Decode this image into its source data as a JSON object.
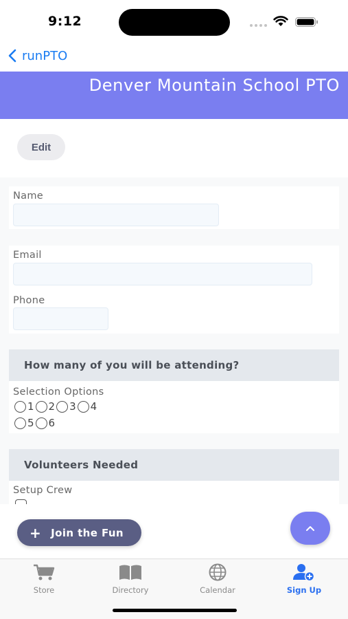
{
  "status": {
    "time": "9:12"
  },
  "nav": {
    "back_label": "runPTO"
  },
  "banner": {
    "title": "Denver Mountain School PTO"
  },
  "edit_label": "Edit",
  "form": {
    "name_label": "Name",
    "email_label": "Email",
    "phone_label": "Phone",
    "attending_header": "How many of you will be attending?",
    "selection_label": "Selection Options",
    "options_row1": [
      "1",
      "2",
      "3",
      "4"
    ],
    "options_row2": [
      "5",
      "6"
    ],
    "volunteers_header": "Volunteers Needed",
    "setup_crew_label": "Setup Crew"
  },
  "join_label": "Join the Fun",
  "tabs": [
    {
      "label": "Store",
      "icon": "cart-icon"
    },
    {
      "label": "Directory",
      "icon": "book-icon"
    },
    {
      "label": "Calendar",
      "icon": "globe-icon"
    },
    {
      "label": "Sign Up",
      "icon": "add-user-icon"
    }
  ],
  "colors": {
    "accent": "#7a7ef0",
    "tab_active": "#2a6ff0",
    "link": "#1a7cf2",
    "join_button": "#5a5e84"
  }
}
